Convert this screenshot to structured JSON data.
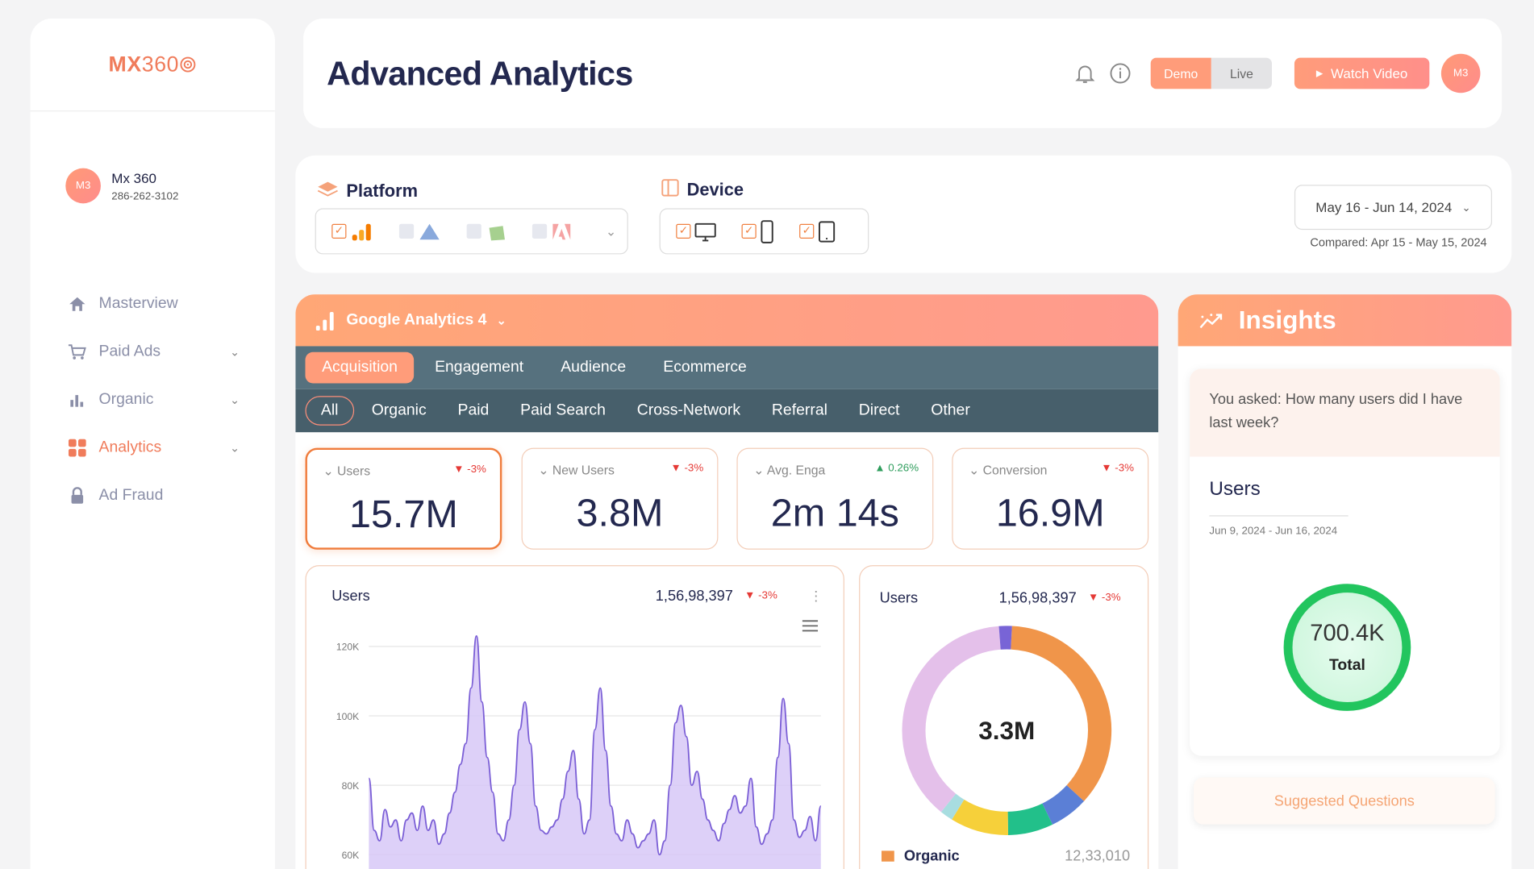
{
  "logo": {
    "main": "MX",
    "sub": "360"
  },
  "user": {
    "initials": "M3",
    "name": "Mx 360",
    "phone": "286-262-3102"
  },
  "nav": [
    "Masterview",
    "Paid Ads",
    "Organic",
    "Analytics",
    "Ad Fraud"
  ],
  "header": {
    "title": "Advanced Analytics",
    "demo": "Demo",
    "live": "Live",
    "watch": "Watch Video",
    "avatar": "M3"
  },
  "filters": {
    "platform": "Platform",
    "device": "Device",
    "date_range": "May 16 - Jun 14, 2024",
    "compared": "Compared: Apr 15 - May 15, 2024"
  },
  "ga": {
    "title": "Google Analytics 4",
    "tabs": [
      "Acquisition",
      "Engagement",
      "Audience",
      "Ecommerce"
    ],
    "subtabs": [
      "All",
      "Organic",
      "Paid",
      "Paid Search",
      "Cross-Network",
      "Referral",
      "Direct",
      "Other"
    ]
  },
  "kpis": [
    {
      "label": "Users",
      "delta": "-3%",
      "value": "15.7M"
    },
    {
      "label": "New Users",
      "delta": "-3%",
      "value": "3.8M"
    },
    {
      "label": "Avg. Enga",
      "delta": "0.26%",
      "value": "2m 14s"
    },
    {
      "label": "Conversion",
      "delta": "-3%",
      "value": "16.9M"
    }
  ],
  "line_chart": {
    "title": "Users",
    "value": "1,56,98,397",
    "delta": "-3%",
    "y_ticks": [
      "120K",
      "100K",
      "80K",
      "60K"
    ]
  },
  "donut": {
    "title": "Users",
    "value": "1,56,98,397",
    "delta": "-3%",
    "center": "3.3M",
    "legend_label": "Organic",
    "legend_value": "12,33,010"
  },
  "insights": {
    "title": "Insights",
    "question": "You asked: How many users did I have last week?",
    "metric": "Users",
    "range": "Jun 9, 2024  -  Jun 16, 2024",
    "total_value": "700.4K",
    "total_label": "Total",
    "suggested": "Suggested Questions"
  },
  "colors": {
    "accent": "#ff9c7a",
    "navy": "#23284f",
    "tab_bar": "#56717e"
  },
  "chart_data": [
    {
      "type": "area",
      "title": "Users",
      "ylim": [
        60000,
        125000
      ],
      "values": [
        82000,
        67000,
        64000,
        73000,
        68000,
        70000,
        64000,
        70000,
        72000,
        67000,
        74000,
        67000,
        70000,
        63000,
        66000,
        72000,
        78000,
        86000,
        92000,
        108000,
        123000,
        104000,
        88000,
        78000,
        66000,
        64000,
        70000,
        80000,
        96000,
        104000,
        92000,
        74000,
        67000,
        66000,
        68000,
        70000,
        76000,
        84000,
        90000,
        76000,
        66000,
        70000,
        96000,
        108000,
        90000,
        74000,
        66000,
        64000,
        70000,
        66000,
        62000,
        64000,
        66000,
        70000,
        60000,
        64000,
        80000,
        98000,
        103000,
        94000,
        80000,
        84000,
        76000,
        70000,
        67000,
        64000,
        69000,
        73000,
        77000,
        72000,
        74000,
        82000,
        68000,
        63000,
        66000,
        70000,
        88000,
        105000,
        92000,
        70000,
        65000,
        67000,
        71000,
        64000,
        74000
      ]
    },
    {
      "type": "pie",
      "center": "3.3M",
      "slices": [
        {
          "color": "#f0954a",
          "value": 36
        },
        {
          "color": "#5b7fd6",
          "value": 6
        },
        {
          "color": "#22c08a",
          "value": 7
        },
        {
          "color": "#f6d03a",
          "value": 9
        },
        {
          "color": "#a8dde0",
          "value": 2
        },
        {
          "color": "#e4c0ea",
          "value": 38
        },
        {
          "color": "#7864d6",
          "value": 2
        }
      ]
    }
  ]
}
